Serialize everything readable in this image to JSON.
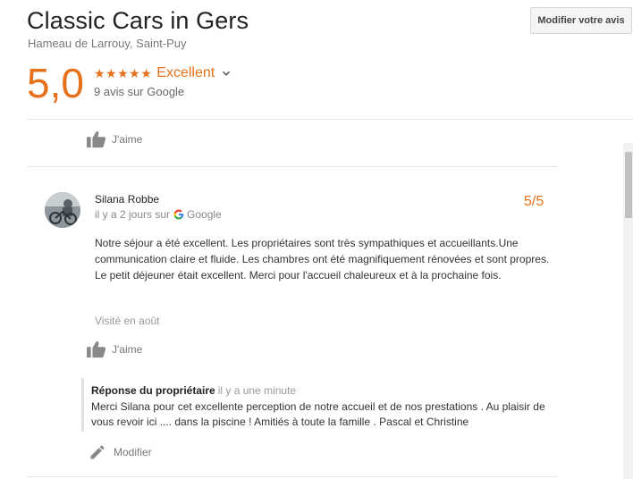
{
  "place": {
    "name": "Classic Cars in Gers",
    "address": "Hameau de Larrouy, Saint-Puy"
  },
  "edit_review_label": "Modifier votre avis",
  "rating": {
    "score": "5,0",
    "stars": "★★★★★",
    "label": "Excellent",
    "count_text": "9 avis sur Google"
  },
  "like_label": "J'aime",
  "review": {
    "author": "Silana Robbe",
    "time_prefix": "il y a 2 jours sur",
    "source": "Google",
    "score": "5/5",
    "text": "Notre séjour a été excellent.  Les propriétaires sont très sympathiques et accueillants.Une communication claire et fluide. Les chambres ont été magnifiquement rénovées et sont propres. Le petit déjeuner était excellent. Merci pour l'accueil chaleureux et à la prochaine fois.",
    "visited": "Visité en août",
    "like_label": "J'aime"
  },
  "owner_reply": {
    "heading": "Réponse du propriétaire",
    "time": "il y a une minute",
    "text": "Merci Silana pour cet excellente perception de notre accueil et de nos prestations . Au plaisir de vous revoir ici .... dans la piscine ! Amitiés à toute la famille . Pascal et Christine",
    "edit_label": "Modifier"
  },
  "colors": {
    "accent": "#e7711b",
    "muted": "#777777"
  }
}
